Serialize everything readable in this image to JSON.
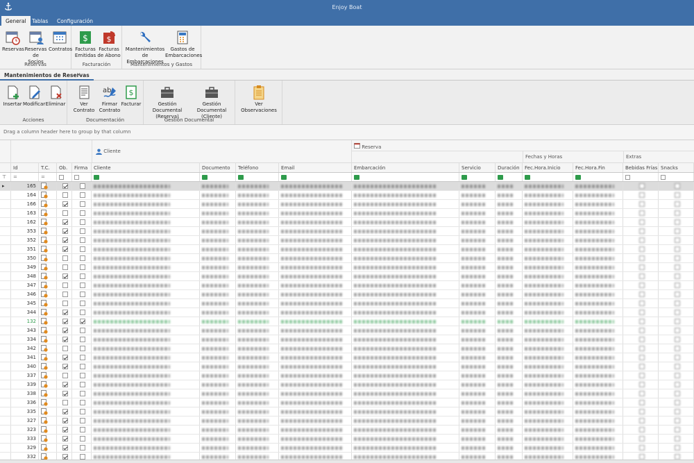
{
  "app": {
    "title": "Enjoy Boat"
  },
  "ribbon_tabs": [
    "General",
    "Tablas",
    "Configuración"
  ],
  "ribbon": {
    "groups": [
      {
        "title": "Reservas",
        "buttons": [
          "Reservas",
          "Reservas\nde Socios",
          "Contratos"
        ]
      },
      {
        "title": "Facturación",
        "buttons": [
          "Facturas\nEmitidas",
          "Facturas\nde Abono"
        ]
      },
      {
        "title": "Mantenimientos y Gastos",
        "buttons": [
          "Mantenimientos\nde Embarcaciones",
          "Gastos de\nEmbarcaciones"
        ]
      }
    ]
  },
  "doc_tab": {
    "label": "Mantenimientos de Reservas",
    "close": "✕"
  },
  "toolbar": {
    "groups": [
      {
        "title": "Acciones",
        "buttons": [
          "Insertar",
          "Modificar",
          "Eliminar"
        ]
      },
      {
        "title": "Documentación",
        "buttons": [
          "Ver Contrato",
          "Firmar\nContrato",
          "Facturar"
        ]
      },
      {
        "title": "Gestión Documental",
        "buttons": [
          "Gestión Documental\n(Reserva)",
          "Gestión Documental\n(Cliente)"
        ]
      },
      {
        "title": "",
        "buttons": [
          "Ver Observaciones"
        ]
      }
    ]
  },
  "group_panel": "Drag a column header here to group by that column",
  "bands": {
    "cliente": "Cliente",
    "reserva": "Reserva",
    "fechas": "Fechas y Horas",
    "extras": "Extras"
  },
  "columns": [
    "Id",
    "T.C.",
    "Ob.",
    "Firma",
    "Cliente",
    "Documento",
    "Teléfono",
    "Email",
    "Embarcación",
    "Servicio",
    "Duración",
    "Fec.Hora.Inicio",
    "Fec.Hora.Fin",
    "Bebidas Frías",
    "Snacks"
  ],
  "rows": [
    {
      "id": "165",
      "ob": true,
      "firma": false,
      "sel": true
    },
    {
      "id": "164",
      "ob": false,
      "firma": false
    },
    {
      "id": "166",
      "ob": true,
      "firma": false
    },
    {
      "id": "163",
      "ob": false,
      "firma": false
    },
    {
      "id": "162",
      "ob": true,
      "firma": false
    },
    {
      "id": "353",
      "ob": true,
      "firma": false
    },
    {
      "id": "352",
      "ob": true,
      "firma": false
    },
    {
      "id": "351",
      "ob": true,
      "firma": false
    },
    {
      "id": "350",
      "ob": false,
      "firma": false
    },
    {
      "id": "349",
      "ob": false,
      "firma": false
    },
    {
      "id": "348",
      "ob": true,
      "firma": false
    },
    {
      "id": "347",
      "ob": false,
      "firma": false
    },
    {
      "id": "346",
      "ob": false,
      "firma": false
    },
    {
      "id": "345",
      "ob": false,
      "firma": false
    },
    {
      "id": "344",
      "ob": true,
      "firma": false
    },
    {
      "id": "132",
      "ob": true,
      "firma": true,
      "green": true
    },
    {
      "id": "343",
      "ob": true,
      "firma": false
    },
    {
      "id": "334",
      "ob": true,
      "firma": false
    },
    {
      "id": "342",
      "ob": false,
      "firma": false
    },
    {
      "id": "341",
      "ob": true,
      "firma": false
    },
    {
      "id": "340",
      "ob": true,
      "firma": false
    },
    {
      "id": "337",
      "ob": false,
      "firma": false
    },
    {
      "id": "339",
      "ob": true,
      "firma": false
    },
    {
      "id": "338",
      "ob": true,
      "firma": false
    },
    {
      "id": "336",
      "ob": false,
      "firma": false
    },
    {
      "id": "335",
      "ob": true,
      "firma": false
    },
    {
      "id": "327",
      "ob": true,
      "firma": false
    },
    {
      "id": "323",
      "ob": true,
      "firma": false
    },
    {
      "id": "333",
      "ob": true,
      "firma": false
    },
    {
      "id": "329",
      "ob": true,
      "firma": false
    },
    {
      "id": "332",
      "ob": true,
      "firma": false
    }
  ],
  "colors": {
    "titlebar": "#3f6fa8",
    "green_row": "#2d9a4a",
    "accent": "#3f6fa8"
  }
}
